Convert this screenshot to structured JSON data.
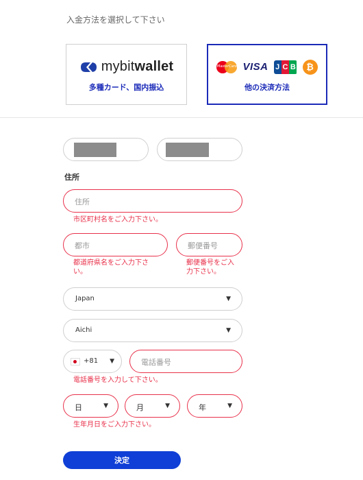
{
  "header": {
    "instruction": "入金方法を選択して下さい"
  },
  "payment_methods": {
    "mybitwallet": {
      "logo_prefix": "mybit",
      "logo_suffix": "wallet",
      "caption": "多種カード、国内振込"
    },
    "other": {
      "caption": "他の決済方法",
      "logos": [
        "mastercard-logo",
        "visa-logo",
        "jcb-logo",
        "bitcoin-logo"
      ],
      "mastercard_text": "MasterCard",
      "visa_text": "VISA"
    }
  },
  "colors": {
    "accent": "#1a2ab8",
    "error": "#e8304a",
    "submit": "#0f3fd6"
  },
  "form": {
    "address_section_label": "住所",
    "address": {
      "placeholder": "住所",
      "error": "市区町村名をご入力下さい。"
    },
    "city": {
      "placeholder": "都市",
      "error": "都道府県名をご入力下さ\nい。"
    },
    "postal": {
      "placeholder": "郵便番号",
      "error": "郵便番号をご入\n力下さい。"
    },
    "country": {
      "value": "Japan"
    },
    "prefecture": {
      "value": "Aichi"
    },
    "phone": {
      "country_code": "+81",
      "placeholder": "電話番号",
      "error": "電話番号を入力して下さい。"
    },
    "birthdate": {
      "day": "日",
      "month": "月",
      "year": "年",
      "error": "生年月日をご入力下さい。"
    },
    "submit_label": "決定"
  }
}
